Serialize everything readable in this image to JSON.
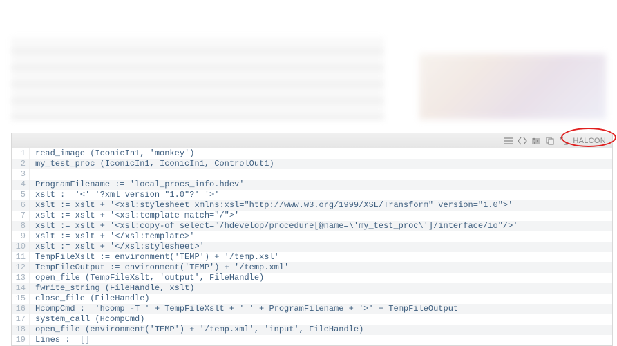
{
  "toolbar": {
    "label": "HALCON"
  },
  "lines": [
    {
      "n": 1,
      "code": "read_image (IconicIn1, 'monkey')"
    },
    {
      "n": 2,
      "code": "my_test_proc (IconicIn1, IconicIn1, ControlOut1)"
    },
    {
      "n": 3,
      "code": ""
    },
    {
      "n": 4,
      "code": "ProgramFilename := 'local_procs_info.hdev'"
    },
    {
      "n": 5,
      "code": "xslt := '<' '?xml version=\"1.0\"?' '>'"
    },
    {
      "n": 6,
      "code": "xslt := xslt + '<xsl:stylesheet xmlns:xsl=\"http://www.w3.org/1999/XSL/Transform\" version=\"1.0\">'"
    },
    {
      "n": 7,
      "code": "xslt := xslt + '<xsl:template match=\"/\">'"
    },
    {
      "n": 8,
      "code": "xslt := xslt + '<xsl:copy-of select=\"/hdevelop/procedure[@name=\\'my_test_proc\\']/interface/io\"/>'"
    },
    {
      "n": 9,
      "code": "xslt := xslt + '</xsl:template>'"
    },
    {
      "n": 10,
      "code": "xslt := xslt + '</xsl:stylesheet>'"
    },
    {
      "n": 11,
      "code": "TempFileXslt := environment('TEMP') + '/temp.xsl'"
    },
    {
      "n": 12,
      "code": "TempFileOutput := environment('TEMP') + '/temp.xml'"
    },
    {
      "n": 13,
      "code": "open_file (TempFileXslt, 'output', FileHandle)"
    },
    {
      "n": 14,
      "code": "fwrite_string (FileHandle, xslt)"
    },
    {
      "n": 15,
      "code": "close_file (FileHandle)"
    },
    {
      "n": 16,
      "code": "HcompCmd := 'hcomp -T ' + TempFileXslt + ' ' + ProgramFilename + '>' + TempFileOutput"
    },
    {
      "n": 17,
      "code": "system_call (HcompCmd)"
    },
    {
      "n": 18,
      "code": "open_file (environment('TEMP') + '/temp.xml', 'input', FileHandle)"
    },
    {
      "n": 19,
      "code": "Lines := []"
    }
  ],
  "icons": {
    "menu": "menu-icon",
    "code": "code-brackets-icon",
    "settings": "settings-icon",
    "copy": "copy-icon",
    "expand": "expand-icon"
  }
}
